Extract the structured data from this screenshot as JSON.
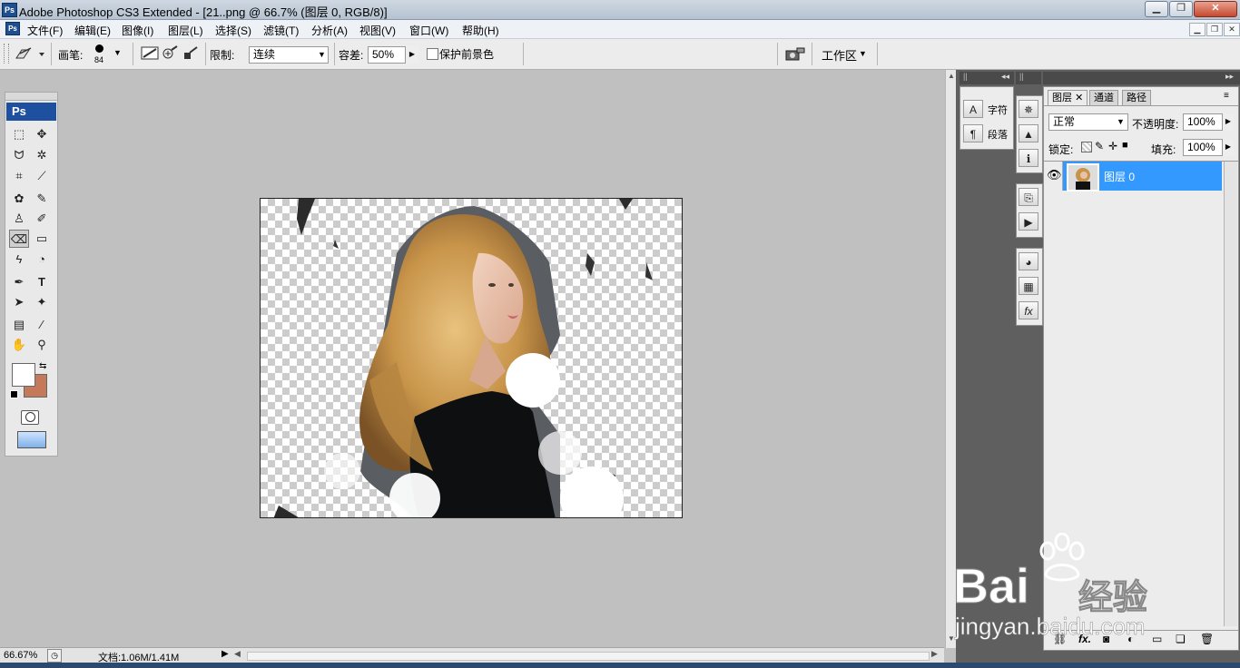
{
  "window": {
    "app_icon": "Ps",
    "title": "Adobe Photoshop CS3 Extended - [21..png @ 66.7% (图层 0, RGB/8)]"
  },
  "menu": [
    "文件(F)",
    "编辑(E)",
    "图像(I)",
    "图层(L)",
    "选择(S)",
    "滤镜(T)",
    "分析(A)",
    "视图(V)",
    "窗口(W)",
    "帮助(H)"
  ],
  "options": {
    "brush_label": "画笔:",
    "brush_size": "84",
    "limit_label": "限制:",
    "limit_value": "连续",
    "tolerance_label": "容差:",
    "tolerance_value": "50%",
    "protect_fg_label": "保护前景色",
    "protect_fg_checked": false,
    "workspace_label": "工作区"
  },
  "tools": {
    "header": "Ps",
    "foreground_color": "#ffffff",
    "background_color": "#c47a5a",
    "selected": "background-eraser"
  },
  "status": {
    "zoom": "66.67%",
    "doc_size": "文档:1.06M/1.41M"
  },
  "side_panels": {
    "char_label": "字符",
    "para_label": "段落"
  },
  "layers_panel": {
    "tabs": [
      "图层",
      "通道",
      "路径"
    ],
    "active_tab": "图层",
    "blend_mode": "正常",
    "opacity_label": "不透明度:",
    "opacity_value": "100%",
    "lock_label": "锁定:",
    "fill_label": "填充:",
    "fill_value": "100%",
    "layers": [
      {
        "name": "图层 0",
        "visible": true,
        "selected": true
      }
    ]
  },
  "watermark": {
    "logo": "Bai",
    "logo_cn": "经验",
    "url": "jingyan.baidu.com"
  },
  "colors": {
    "selection_blue": "#3399ff",
    "panel_dark": "#5f5f5f",
    "canvas_bg": "#c0c0c0"
  }
}
